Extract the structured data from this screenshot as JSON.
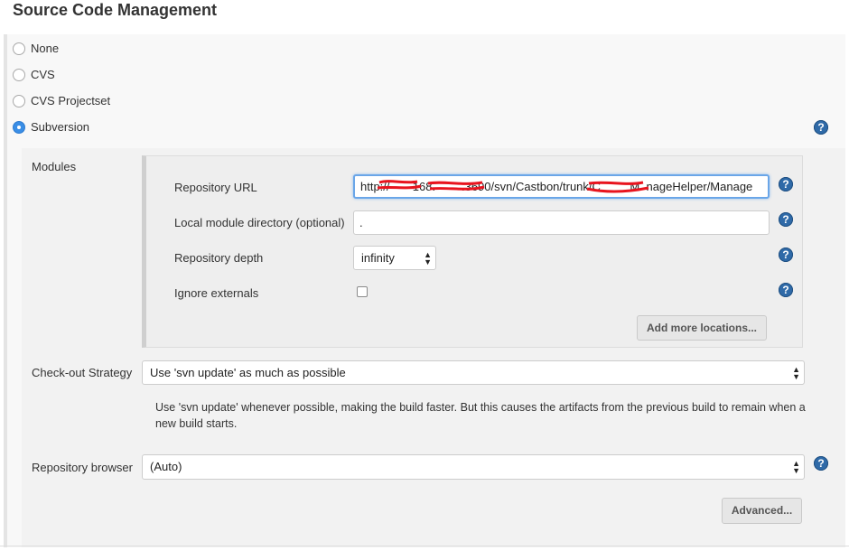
{
  "section": {
    "title": "Source Code Management"
  },
  "scm_options": [
    {
      "label": "None",
      "checked": false
    },
    {
      "label": "CVS",
      "checked": false
    },
    {
      "label": "CVS Projectset",
      "checked": false
    },
    {
      "label": "Subversion",
      "checked": true
    }
  ],
  "modules": {
    "label": "Modules",
    "repository_url": {
      "label": "Repository URL",
      "value": "http://       168.        .3690/svn/Castbon/trunk/C         M  nageHelper/Manage"
    },
    "local_dir": {
      "label": "Local module directory (optional)",
      "value": "."
    },
    "depth": {
      "label": "Repository depth",
      "selected": "infinity"
    },
    "ignore_externals": {
      "label": "Ignore externals",
      "checked": false
    },
    "add_more_label": "Add more locations..."
  },
  "checkout": {
    "label": "Check-out Strategy",
    "selected": "Use 'svn update' as much as possible",
    "description": "Use 'svn update' whenever possible, making the build faster. But this causes the artifacts from the previous build to remain when a new build starts."
  },
  "browser": {
    "label": "Repository browser",
    "selected": "(Auto)"
  },
  "advanced_label": "Advanced...",
  "help_glyph": "?",
  "colors": {
    "accent": "#3a8ee6",
    "help": "#2f6aa8",
    "redaction": "#e8141e"
  }
}
